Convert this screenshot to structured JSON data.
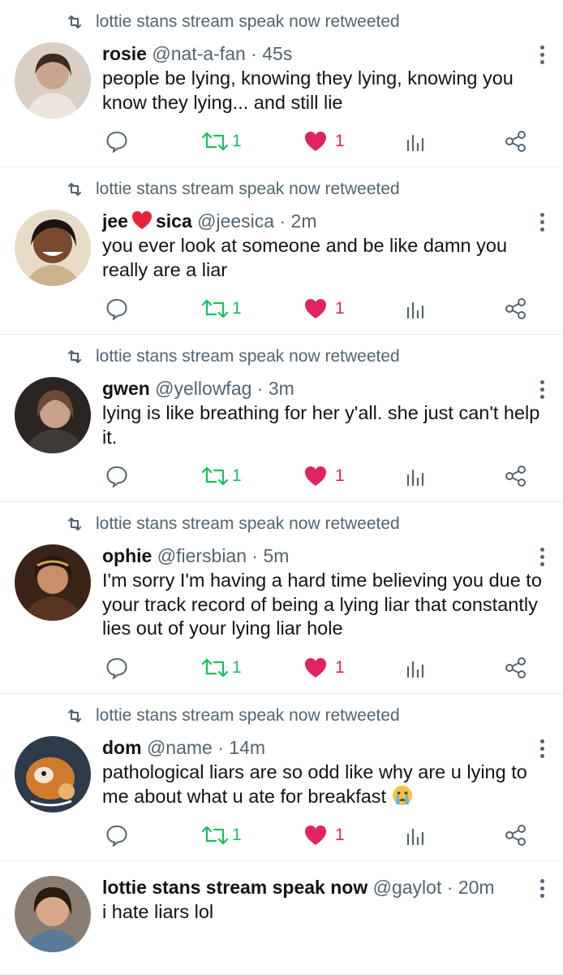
{
  "retweeter": "lottie stans stream speak now retweeted",
  "tweets": [
    {
      "name": "rosie",
      "handle": "@nat-a-fan",
      "time": "45s",
      "text": "people be lying, knowing they lying, knowing you know they lying... and still lie",
      "retweets": "1",
      "likes": "1"
    },
    {
      "name_a": "jee",
      "name_b": "sica",
      "handle": "@jeesica",
      "time": "2m",
      "text": "you ever look at someone and be like damn you really are a liar",
      "retweets": "1",
      "likes": "1"
    },
    {
      "name": "gwen",
      "handle": "@yellowfag",
      "time": "3m",
      "text": "lying is like breathing for her y'all. she just can't help it.",
      "retweets": "1",
      "likes": "1"
    },
    {
      "name": "ophie",
      "handle": "@fiersbian",
      "time": "5m",
      "text": "I'm sorry I'm having a hard time believing you due to your track record of being a lying liar that constantly lies out of your lying liar hole",
      "retweets": "1",
      "likes": "1"
    },
    {
      "name": "dom",
      "handle": "@name",
      "time": "14m",
      "text": "pathological liars are so odd like why are u lying to me about what u ate for breakfast",
      "retweets": "1",
      "likes": "1"
    },
    {
      "name": "lottie stans stream speak now",
      "handle": "@gaylot",
      "time": "20m",
      "text": "i hate liars lol"
    }
  ],
  "colors": {
    "retweet_green": "#17bf63",
    "like_red": "#e0245e",
    "muted": "#536471"
  }
}
